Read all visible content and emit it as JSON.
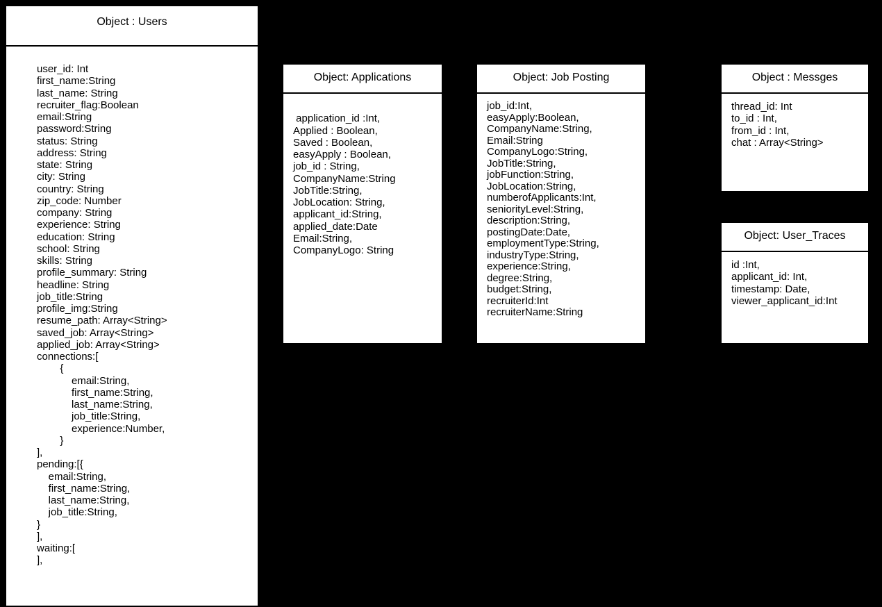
{
  "users": {
    "title": "Object : Users",
    "body": "user_id: Int\nfirst_name:String\nlast_name: String\nrecruiter_flag:Boolean\nemail:String\npassword:String\nstatus: String\naddress: String\nstate: String\ncity: String\ncountry: String\nzip_code: Number\ncompany: String\nexperience: String\neducation: String\nschool: String\nskills: String\nprofile_summary: String\nheadline: String\njob_title:String\nprofile_img:String\nresume_path: Array<String>\nsaved_job: Array<String>\napplied_job: Array<String>\nconnections:[\n        {\n            email:String,\n            first_name:String,\n            last_name:String,\n            job_title:String,\n            experience:Number,\n        }\n],\npending:[{\n    email:String,\n    first_name:String,\n    last_name:String,\n    job_title:String,\n}\n],\nwaiting:[\n],"
  },
  "applications": {
    "title": "Object: Applications",
    "body": "\n application_id :Int,\nApplied : Boolean,\nSaved : Boolean,\neasyApply : Boolean,\njob_id : String,\nCompanyName:String\nJobTitle:String,\nJobLocation: String,\napplicant_id:String,\napplied_date:Date\nEmail:String,\nCompanyLogo: String"
  },
  "jobposting": {
    "title": "Object: Job Posting",
    "body": "job_id:Int,\neasyApply:Boolean,\nCompanyName:String,\nEmail:String\nCompanyLogo:String,\nJobTitle:String,\njobFunction:String,\nJobLocation:String,\nnumberofApplicants:Int,\nseniorityLevel:String,\ndescription:String,\npostingDate:Date,\nemploymentType:String,\nindustryType:String,\nexperience:String,\ndegree:String,\nbudget:String,\nrecruiterId:Int\nrecruiterName:String"
  },
  "messages": {
    "title": "Object : Messges",
    "body": "thread_id: Int\nto_id : Int,\nfrom_id : Int,\nchat : Array<String>"
  },
  "usertraces": {
    "title": "Object: User_Traces",
    "body": "id :Int,\napplicant_id: Int,\ntimestamp: Date,\nviewer_applicant_id:Int"
  }
}
